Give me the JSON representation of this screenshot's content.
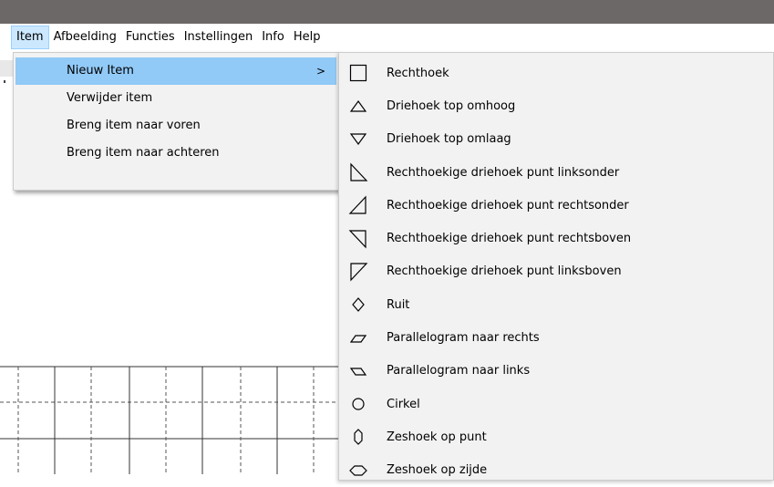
{
  "menubar": {
    "items": [
      {
        "label": "Item",
        "open": true
      },
      {
        "label": "Afbeelding"
      },
      {
        "label": "Functies"
      },
      {
        "label": "Instellingen"
      },
      {
        "label": "Info"
      },
      {
        "label": "Help"
      }
    ]
  },
  "item_menu": {
    "items": [
      {
        "label": "Nieuw Item",
        "has_submenu": true,
        "arrow": ">"
      },
      {
        "label": "Verwijder item"
      },
      {
        "label": "Breng item naar voren"
      },
      {
        "label": "Breng item naar achteren"
      }
    ]
  },
  "new_item_submenu": {
    "items": [
      {
        "label": "Rechthoek",
        "icon": "rectangle-icon"
      },
      {
        "label": "Driehoek top omhoog",
        "icon": "triangle-up-icon"
      },
      {
        "label": "Driehoek top omlaag",
        "icon": "triangle-down-icon"
      },
      {
        "label": "Rechthoekige driehoek punt linksonder",
        "icon": "right-triangle-bottom-left-icon"
      },
      {
        "label": "Rechthoekige driehoek punt rechtsonder",
        "icon": "right-triangle-bottom-right-icon"
      },
      {
        "label": "Rechthoekige driehoek punt rechtsboven",
        "icon": "right-triangle-top-right-icon"
      },
      {
        "label": "Rechthoekige driehoek punt linksboven",
        "icon": "right-triangle-top-left-icon"
      },
      {
        "label": "Ruit",
        "icon": "diamond-icon"
      },
      {
        "label": "Parallelogram naar rechts",
        "icon": "parallelogram-right-icon"
      },
      {
        "label": "Parallelogram naar links",
        "icon": "parallelogram-left-icon"
      },
      {
        "label": "Cirkel",
        "icon": "circle-icon"
      },
      {
        "label": "Zeshoek op punt",
        "icon": "hexagon-point-icon"
      },
      {
        "label": "Zeshoek op zijde",
        "icon": "hexagon-side-icon"
      }
    ]
  },
  "colors": {
    "titlebar": "#6d6868",
    "menu_open_bg": "#cce8ff",
    "menu_highlight": "#91c9f7",
    "menu_bg": "#f2f2f2"
  }
}
